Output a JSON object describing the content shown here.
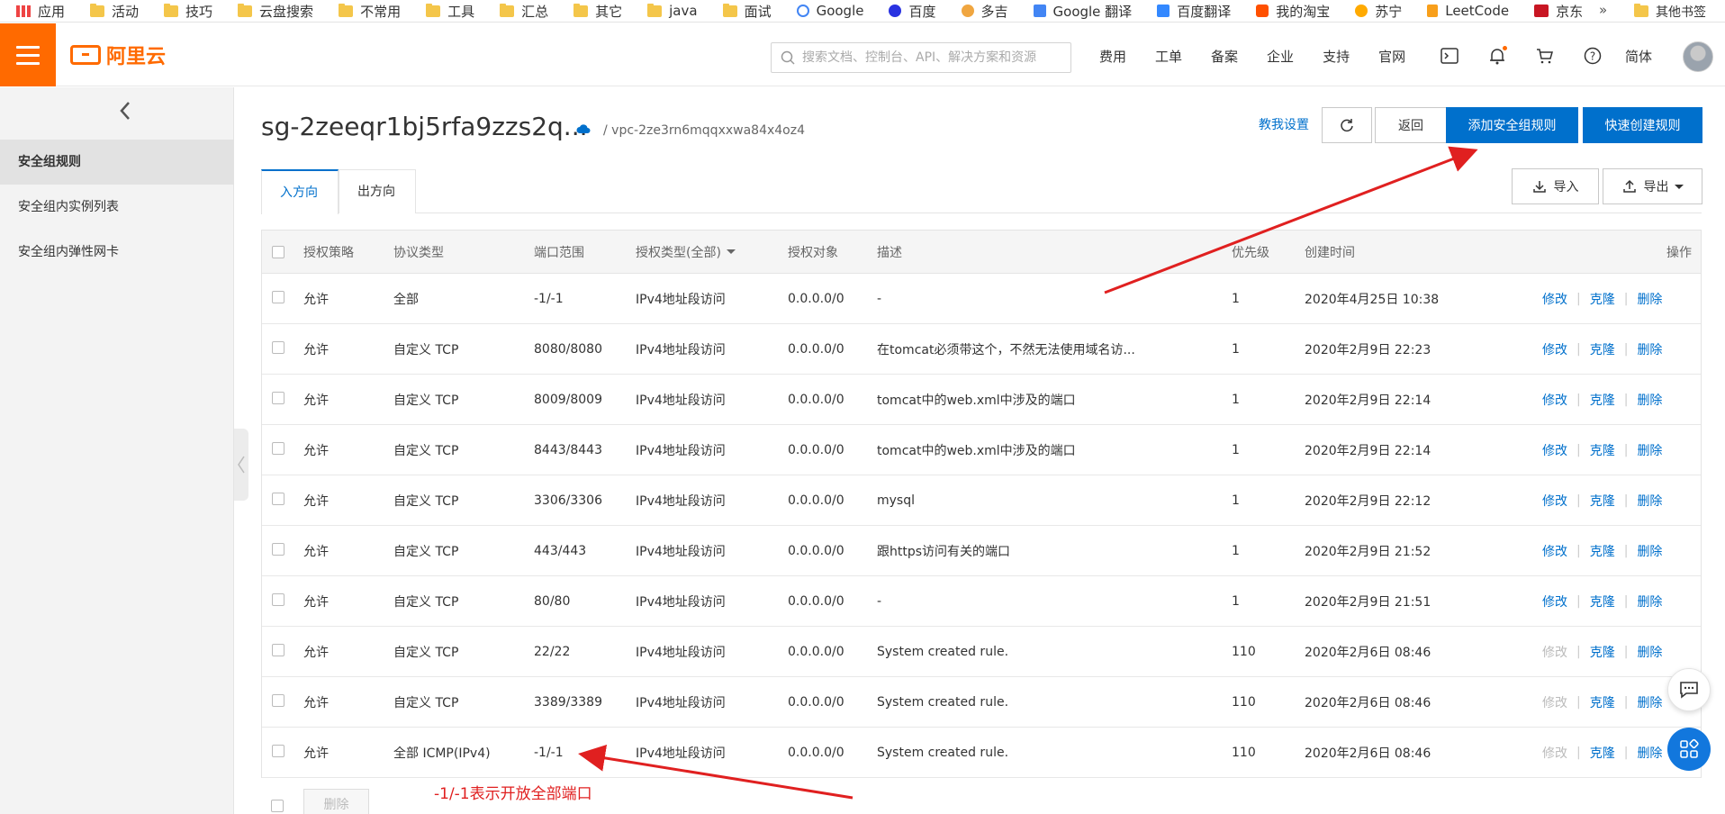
{
  "bookmarks": [
    {
      "label": "应用",
      "icon": "apps-grid-icon"
    },
    {
      "label": "活动",
      "icon": "folder-icon"
    },
    {
      "label": "技巧",
      "icon": "folder-icon"
    },
    {
      "label": "云盘搜索",
      "icon": "folder-icon"
    },
    {
      "label": "不常用",
      "icon": "folder-icon"
    },
    {
      "label": "工具",
      "icon": "folder-icon"
    },
    {
      "label": "汇总",
      "icon": "folder-icon"
    },
    {
      "label": "其它",
      "icon": "folder-icon"
    },
    {
      "label": "java",
      "icon": "folder-icon"
    },
    {
      "label": "面试",
      "icon": "folder-icon"
    },
    {
      "label": "Google",
      "icon": "google-icon"
    },
    {
      "label": "百度",
      "icon": "baidu-icon"
    },
    {
      "label": "多吉",
      "icon": "dogedoge-icon"
    },
    {
      "label": "Google 翻译",
      "icon": "google-translate-icon"
    },
    {
      "label": "百度翻译",
      "icon": "baidu-translate-icon"
    },
    {
      "label": "我的淘宝",
      "icon": "taobao-icon"
    },
    {
      "label": "苏宁",
      "icon": "suning-icon"
    },
    {
      "label": "LeetCode",
      "icon": "leetcode-icon"
    },
    {
      "label": "京东",
      "icon": "jd-icon"
    }
  ],
  "bookmarks_more": "»",
  "bookmarks_other": "其他书签",
  "header": {
    "search_placeholder": "搜索文档、控制台、API、解决方案和资源",
    "nav": [
      "费用",
      "工单",
      "备案",
      "企业",
      "支持",
      "官网"
    ],
    "lang": "简体",
    "brand_color": "#ff6a00"
  },
  "sidebar": {
    "items": [
      "安全组规则",
      "安全组内实例列表",
      "安全组内弹性网卡"
    ],
    "active_index": 0
  },
  "page": {
    "title": "sg-2zeeqr1bj5rfa9zzs2q...",
    "vpc": "/ vpc-2ze3rn6mqqxxwa84x4oz4",
    "help_link": "教我设置",
    "back_button": "返回",
    "add_rule_button": "添加安全组规则",
    "quick_create_button": "快速创建规则",
    "import_button": "导入",
    "export_button": "导出",
    "accent_color": "#0070cc"
  },
  "tabs": [
    "入方向",
    "出方向"
  ],
  "table": {
    "columns": [
      "授权策略",
      "协议类型",
      "端口范围",
      "授权类型(全部)",
      "授权对象",
      "描述",
      "优先级",
      "创建时间",
      "操作"
    ],
    "actions": [
      "修改",
      "克隆",
      "删除"
    ],
    "rows": [
      {
        "policy": "允许",
        "protocol": "全部",
        "port": "-1/-1",
        "auth_type": "IPv4地址段访问",
        "target": "0.0.0.0/0",
        "desc": "-",
        "priority": "1",
        "created": "2020年4月25日 10:38",
        "edit_disabled": false
      },
      {
        "policy": "允许",
        "protocol": "自定义 TCP",
        "port": "8080/8080",
        "auth_type": "IPv4地址段访问",
        "target": "0.0.0.0/0",
        "desc": "在tomcat必须带这个，不然无法使用域名访...",
        "priority": "1",
        "created": "2020年2月9日 22:23",
        "edit_disabled": false
      },
      {
        "policy": "允许",
        "protocol": "自定义 TCP",
        "port": "8009/8009",
        "auth_type": "IPv4地址段访问",
        "target": "0.0.0.0/0",
        "desc": "tomcat中的web.xml中涉及的端口",
        "priority": "1",
        "created": "2020年2月9日 22:14",
        "edit_disabled": false
      },
      {
        "policy": "允许",
        "protocol": "自定义 TCP",
        "port": "8443/8443",
        "auth_type": "IPv4地址段访问",
        "target": "0.0.0.0/0",
        "desc": "tomcat中的web.xml中涉及的端口",
        "priority": "1",
        "created": "2020年2月9日 22:14",
        "edit_disabled": false
      },
      {
        "policy": "允许",
        "protocol": "自定义 TCP",
        "port": "3306/3306",
        "auth_type": "IPv4地址段访问",
        "target": "0.0.0.0/0",
        "desc": "mysql",
        "priority": "1",
        "created": "2020年2月9日 22:12",
        "edit_disabled": false
      },
      {
        "policy": "允许",
        "protocol": "自定义 TCP",
        "port": "443/443",
        "auth_type": "IPv4地址段访问",
        "target": "0.0.0.0/0",
        "desc": "跟https访问有关的端口",
        "priority": "1",
        "created": "2020年2月9日 21:52",
        "edit_disabled": false
      },
      {
        "policy": "允许",
        "protocol": "自定义 TCP",
        "port": "80/80",
        "auth_type": "IPv4地址段访问",
        "target": "0.0.0.0/0",
        "desc": "-",
        "priority": "1",
        "created": "2020年2月9日 21:51",
        "edit_disabled": false
      },
      {
        "policy": "允许",
        "protocol": "自定义 TCP",
        "port": "22/22",
        "auth_type": "IPv4地址段访问",
        "target": "0.0.0.0/0",
        "desc": "System created rule.",
        "priority": "110",
        "created": "2020年2月6日 08:46",
        "edit_disabled": true
      },
      {
        "policy": "允许",
        "protocol": "自定义 TCP",
        "port": "3389/3389",
        "auth_type": "IPv4地址段访问",
        "target": "0.0.0.0/0",
        "desc": "System created rule.",
        "priority": "110",
        "created": "2020年2月6日 08:46",
        "edit_disabled": true
      },
      {
        "policy": "允许",
        "protocol": "全部 ICMP(IPv4)",
        "port": "-1/-1",
        "auth_type": "IPv4地址段访问",
        "target": "0.0.0.0/0",
        "desc": "System created rule.",
        "priority": "110",
        "created": "2020年2月6日 08:46",
        "edit_disabled": true
      }
    ]
  },
  "bottom": {
    "delete_button": "删除"
  },
  "annotation": {
    "text": "-1/-1表示开放全部端口",
    "color": "#e02020"
  }
}
